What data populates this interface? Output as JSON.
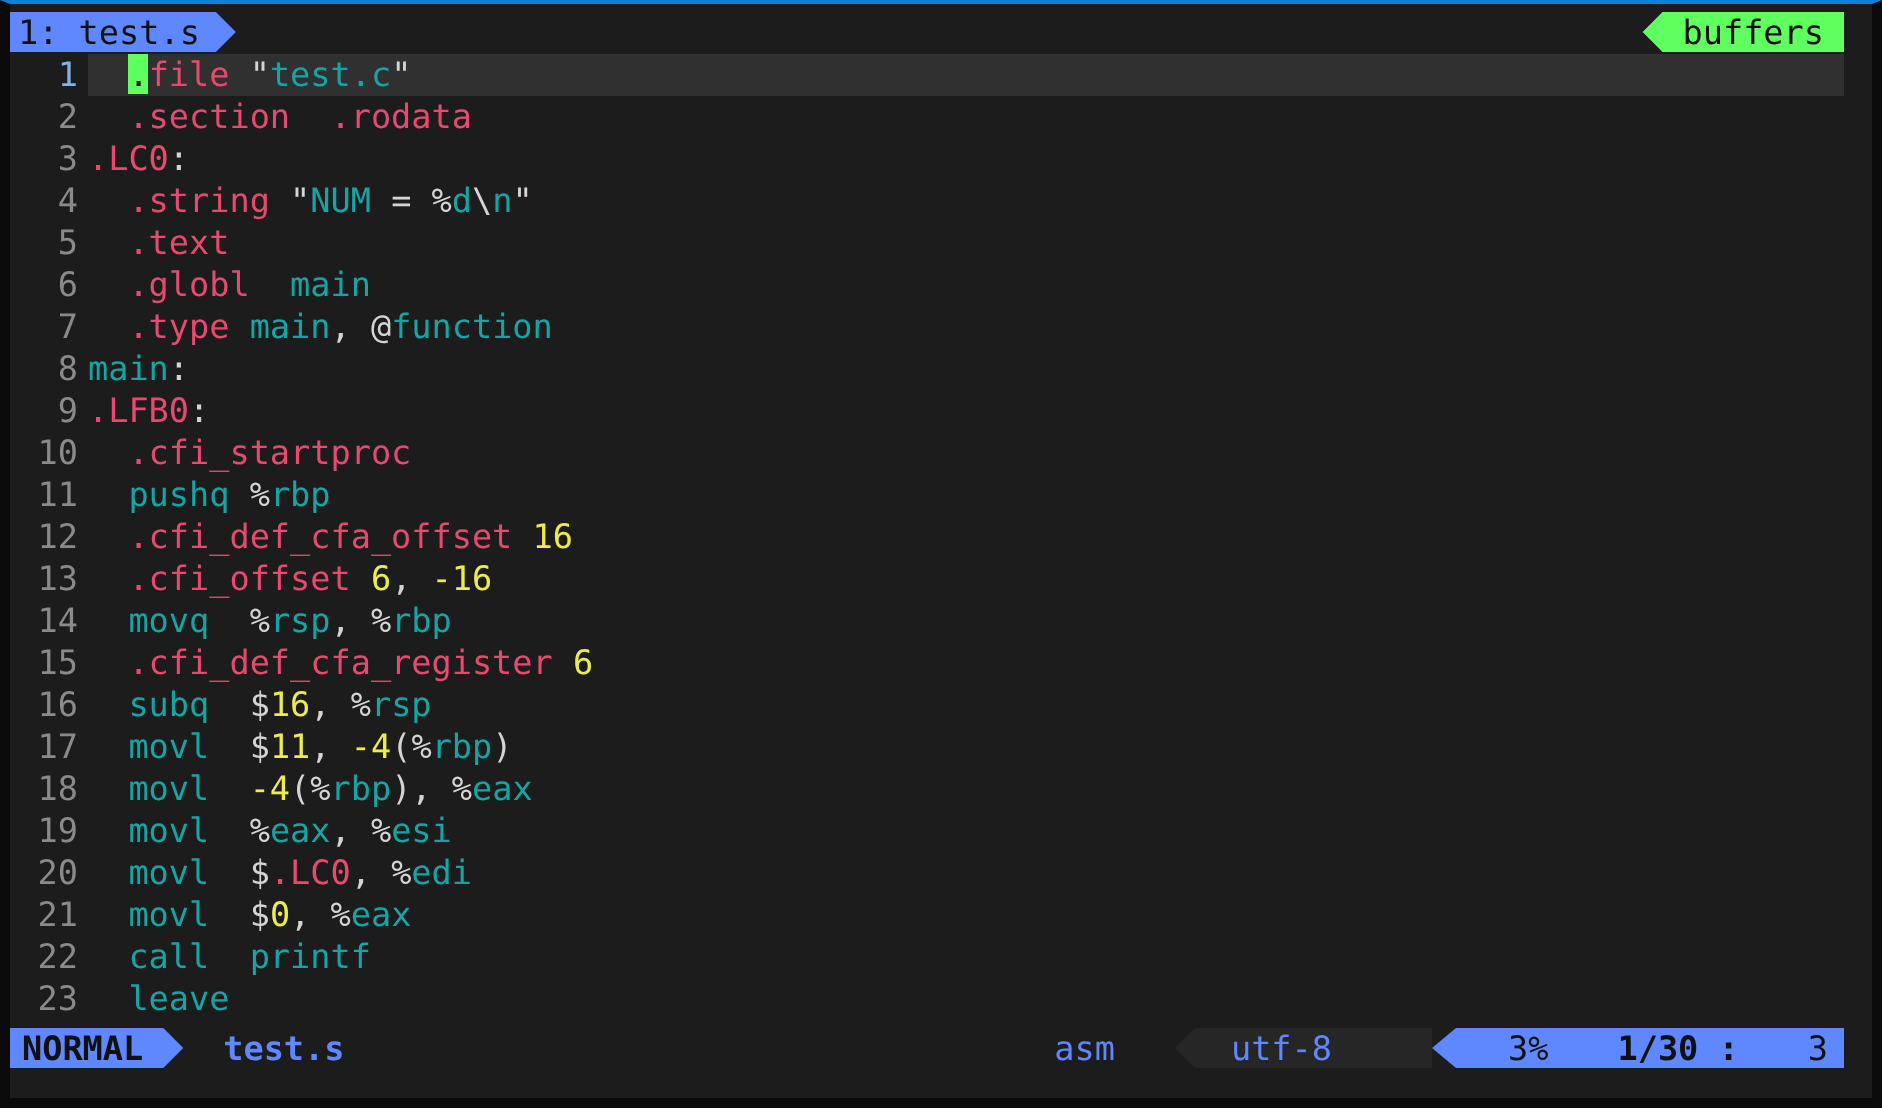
{
  "tabline": {
    "tabs": [
      {
        "label": "1: test.s",
        "selected": true
      }
    ],
    "buffers_label": "buffers"
  },
  "lines": [
    {
      "number": "1",
      "current": true,
      "indented": true,
      "tokens": [
        {
          "kind": "cursor",
          "text": "."
        },
        {
          "kind": "keyword",
          "text": "file "
        },
        {
          "kind": "plain",
          "text": "\""
        },
        {
          "kind": "name",
          "text": "test.c"
        },
        {
          "kind": "plain",
          "text": "\""
        }
      ]
    },
    {
      "number": "2",
      "current": false,
      "indented": true,
      "tokens": [
        {
          "kind": "keyword",
          "text": ".section  .rodata"
        }
      ]
    },
    {
      "number": "3",
      "current": false,
      "indented": false,
      "tokens": [
        {
          "kind": "keyword",
          "text": ".LC0"
        },
        {
          "kind": "plain",
          "text": ":"
        }
      ]
    },
    {
      "number": "4",
      "current": false,
      "indented": true,
      "tokens": [
        {
          "kind": "keyword",
          "text": ".string "
        },
        {
          "kind": "plain",
          "text": "\""
        },
        {
          "kind": "name",
          "text": "NUM "
        },
        {
          "kind": "plain",
          "text": "= %"
        },
        {
          "kind": "name",
          "text": "d"
        },
        {
          "kind": "plain",
          "text": "\\"
        },
        {
          "kind": "name",
          "text": "n"
        },
        {
          "kind": "plain",
          "text": "\""
        }
      ]
    },
    {
      "number": "5",
      "current": false,
      "indented": true,
      "tokens": [
        {
          "kind": "keyword",
          "text": ".text"
        }
      ]
    },
    {
      "number": "6",
      "current": false,
      "indented": true,
      "tokens": [
        {
          "kind": "keyword",
          "text": ".globl  "
        },
        {
          "kind": "name",
          "text": "main"
        }
      ]
    },
    {
      "number": "7",
      "current": false,
      "indented": true,
      "tokens": [
        {
          "kind": "keyword",
          "text": ".type "
        },
        {
          "kind": "name",
          "text": "main"
        },
        {
          "kind": "plain",
          "text": ", @"
        },
        {
          "kind": "name",
          "text": "function"
        }
      ]
    },
    {
      "number": "8",
      "current": false,
      "indented": false,
      "tokens": [
        {
          "kind": "name",
          "text": "main"
        },
        {
          "kind": "plain",
          "text": ":"
        }
      ]
    },
    {
      "number": "9",
      "current": false,
      "indented": false,
      "tokens": [
        {
          "kind": "keyword",
          "text": ".LFB0"
        },
        {
          "kind": "plain",
          "text": ":"
        }
      ]
    },
    {
      "number": "10",
      "current": false,
      "indented": true,
      "tokens": [
        {
          "kind": "keyword",
          "text": ".cfi_startproc"
        }
      ]
    },
    {
      "number": "11",
      "current": false,
      "indented": true,
      "tokens": [
        {
          "kind": "name",
          "text": "pushq "
        },
        {
          "kind": "plain",
          "text": "%"
        },
        {
          "kind": "name",
          "text": "rbp"
        }
      ]
    },
    {
      "number": "12",
      "current": false,
      "indented": true,
      "tokens": [
        {
          "kind": "keyword",
          "text": ".cfi_def_cfa_offset "
        },
        {
          "kind": "number",
          "text": "16"
        }
      ]
    },
    {
      "number": "13",
      "current": false,
      "indented": true,
      "tokens": [
        {
          "kind": "keyword",
          "text": ".cfi_offset "
        },
        {
          "kind": "number",
          "text": "6"
        },
        {
          "kind": "plain",
          "text": ", "
        },
        {
          "kind": "number",
          "text": "-16"
        }
      ]
    },
    {
      "number": "14",
      "current": false,
      "indented": true,
      "tokens": [
        {
          "kind": "name",
          "text": "movq"
        },
        {
          "kind": "plain",
          "text": "  %"
        },
        {
          "kind": "name",
          "text": "rsp"
        },
        {
          "kind": "plain",
          "text": ", %"
        },
        {
          "kind": "name",
          "text": "rbp"
        }
      ]
    },
    {
      "number": "15",
      "current": false,
      "indented": true,
      "tokens": [
        {
          "kind": "keyword",
          "text": ".cfi_def_cfa_register "
        },
        {
          "kind": "number",
          "text": "6"
        }
      ]
    },
    {
      "number": "16",
      "current": false,
      "indented": true,
      "tokens": [
        {
          "kind": "name",
          "text": "subq"
        },
        {
          "kind": "plain",
          "text": "  $"
        },
        {
          "kind": "number",
          "text": "16"
        },
        {
          "kind": "plain",
          "text": ", %"
        },
        {
          "kind": "name",
          "text": "rsp"
        }
      ]
    },
    {
      "number": "17",
      "current": false,
      "indented": true,
      "tokens": [
        {
          "kind": "name",
          "text": "movl"
        },
        {
          "kind": "plain",
          "text": "  $"
        },
        {
          "kind": "number",
          "text": "11"
        },
        {
          "kind": "plain",
          "text": ", "
        },
        {
          "kind": "number",
          "text": "-4"
        },
        {
          "kind": "plain",
          "text": "(%"
        },
        {
          "kind": "name",
          "text": "rbp"
        },
        {
          "kind": "plain",
          "text": ")"
        }
      ]
    },
    {
      "number": "18",
      "current": false,
      "indented": true,
      "tokens": [
        {
          "kind": "name",
          "text": "movl  "
        },
        {
          "kind": "number",
          "text": "-4"
        },
        {
          "kind": "plain",
          "text": "(%"
        },
        {
          "kind": "name",
          "text": "rbp"
        },
        {
          "kind": "plain",
          "text": "), %"
        },
        {
          "kind": "name",
          "text": "eax"
        }
      ]
    },
    {
      "number": "19",
      "current": false,
      "indented": true,
      "tokens": [
        {
          "kind": "name",
          "text": "movl"
        },
        {
          "kind": "plain",
          "text": "  %"
        },
        {
          "kind": "name",
          "text": "eax"
        },
        {
          "kind": "plain",
          "text": ", %"
        },
        {
          "kind": "name",
          "text": "esi"
        }
      ]
    },
    {
      "number": "20",
      "current": false,
      "indented": true,
      "tokens": [
        {
          "kind": "name",
          "text": "movl"
        },
        {
          "kind": "plain",
          "text": "  $"
        },
        {
          "kind": "keyword",
          "text": ".LC0"
        },
        {
          "kind": "plain",
          "text": ", %"
        },
        {
          "kind": "name",
          "text": "edi"
        }
      ]
    },
    {
      "number": "21",
      "current": false,
      "indented": true,
      "tokens": [
        {
          "kind": "name",
          "text": "movl"
        },
        {
          "kind": "plain",
          "text": "  $"
        },
        {
          "kind": "number",
          "text": "0"
        },
        {
          "kind": "plain",
          "text": ", %"
        },
        {
          "kind": "name",
          "text": "eax"
        }
      ]
    },
    {
      "number": "22",
      "current": false,
      "indented": true,
      "tokens": [
        {
          "kind": "name",
          "text": "call  printf"
        }
      ]
    },
    {
      "number": "23",
      "current": false,
      "indented": true,
      "tokens": [
        {
          "kind": "name",
          "text": "leave"
        }
      ]
    }
  ],
  "status_bar": {
    "mode": "NORMAL",
    "file": "test.s",
    "filetype": "asm",
    "encoding": "utf-8",
    "percent": "3%",
    "position": "1/30 :",
    "column": "3"
  }
}
